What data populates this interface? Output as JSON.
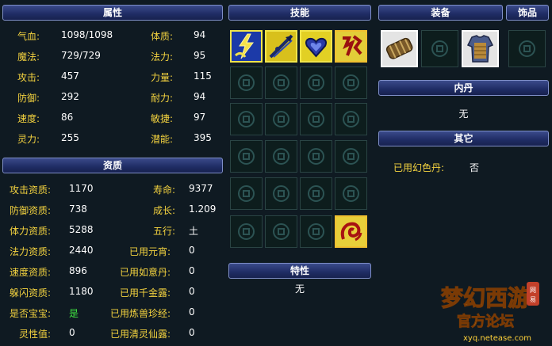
{
  "panels": {
    "attributes_title": "属性",
    "aptitude_title": "资质",
    "skills_title": "技能",
    "special_title": "特性",
    "equipment_title": "装备",
    "accessory_title": "饰品",
    "neidan_title": "内丹",
    "other_title": "其它"
  },
  "attributes": {
    "left": [
      {
        "label": "气血:",
        "value": "1098/1098"
      },
      {
        "label": "魔法:",
        "value": "729/729"
      },
      {
        "label": "攻击:",
        "value": "457"
      },
      {
        "label": "防御:",
        "value": "292"
      },
      {
        "label": "速度:",
        "value": "86"
      },
      {
        "label": "灵力:",
        "value": "255"
      }
    ],
    "right": [
      {
        "label": "体质:",
        "value": "94"
      },
      {
        "label": "法力:",
        "value": "95"
      },
      {
        "label": "力量:",
        "value": "115"
      },
      {
        "label": "耐力:",
        "value": "94"
      },
      {
        "label": "敏捷:",
        "value": "97"
      },
      {
        "label": "潜能:",
        "value": "395"
      }
    ]
  },
  "aptitude": {
    "left": [
      {
        "label": "攻击资质:",
        "value": "1170"
      },
      {
        "label": "防御资质:",
        "value": "738"
      },
      {
        "label": "体力资质:",
        "value": "5288"
      },
      {
        "label": "法力资质:",
        "value": "2440"
      },
      {
        "label": "速度资质:",
        "value": "896"
      },
      {
        "label": "躲闪资质:",
        "value": "1180"
      },
      {
        "label": "是否宝宝:",
        "value": "是"
      },
      {
        "label": "灵性值:",
        "value": "0"
      }
    ],
    "right": [
      {
        "label": "寿命:",
        "value": "9377"
      },
      {
        "label": "成长:",
        "value": "1.209"
      },
      {
        "label": "五行:",
        "value": "土"
      },
      {
        "label": "已用元宵:",
        "value": "0"
      },
      {
        "label": "已用如意丹:",
        "value": "0"
      },
      {
        "label": "已用千金露:",
        "value": "0"
      },
      {
        "label": "已用炼兽珍经:",
        "value": "0"
      },
      {
        "label": "已用清灵仙露:",
        "value": "0"
      }
    ]
  },
  "special": {
    "value": "无"
  },
  "neidan": {
    "value": "无"
  },
  "other": {
    "label": "已用幻色丹:",
    "value": "否"
  },
  "skills": {
    "icons": [
      "skill-lightning-icon",
      "skill-spear-icon",
      "skill-heart-icon",
      "skill-rune-icon",
      "skill-swirl-icon"
    ]
  },
  "equipment": {
    "icons": [
      "armguard-icon",
      "armor-icon"
    ]
  },
  "logo": {
    "brand": "梦幻西游",
    "sub": "官方论坛",
    "url": "xyq.netease.com",
    "badge": "网易"
  }
}
